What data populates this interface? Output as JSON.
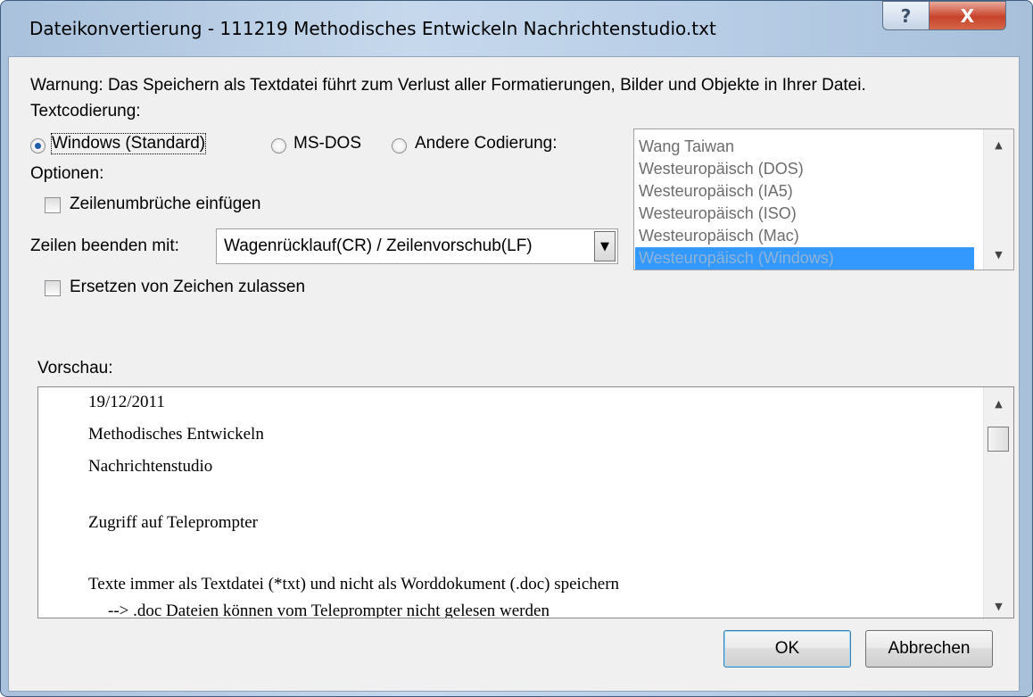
{
  "window": {
    "title": "Dateikonvertierung - 111219 Methodisches Entwickeln Nachrichtenstudio.txt",
    "help_label": "?",
    "close_label": "X"
  },
  "warning": "Warnung: Das Speichern als Textdatei führt zum Verlust aller Formatierungen, Bilder und Objekte in Ihrer Datei.",
  "encoding": {
    "label": "Textcodierung:",
    "options": [
      {
        "label": "Windows (Standard)",
        "selected": true
      },
      {
        "label": "MS-DOS",
        "selected": false
      },
      {
        "label": "Andere Codierung:",
        "selected": false
      }
    ],
    "list": {
      "items": [
        "Wang Taiwan",
        "Westeuropäisch (DOS)",
        "Westeuropäisch (IA5)",
        "Westeuropäisch (ISO)",
        "Westeuropäisch (Mac)",
        "Westeuropäisch (Windows)"
      ],
      "selected_index": 5
    }
  },
  "options": {
    "label": "Optionen:",
    "insert_line_breaks": {
      "label": "Zeilenumbrüche einfügen",
      "checked": false
    },
    "end_lines_label": "Zeilen beenden mit:",
    "end_lines_value": "Wagenrücklauf(CR) / Zeilenvorschub(LF)",
    "allow_substitution": {
      "label": "Ersetzen von Zeichen zulassen",
      "checked": false
    }
  },
  "preview": {
    "label": "Vorschau:",
    "lines": [
      "19/12/2011",
      "Methodisches Entwickeln",
      "Nachrichtenstudio",
      "",
      "Zugriff auf Teleprompter",
      "",
      "Texte immer als Textdatei (*txt) und nicht als Worddokument (.doc) speichern",
      "  --> .doc Dateien können vom Teleprompter nicht gelesen werden"
    ]
  },
  "buttons": {
    "ok": "OK",
    "cancel": "Abbrechen"
  }
}
